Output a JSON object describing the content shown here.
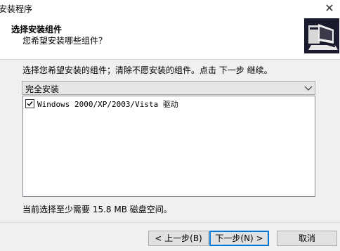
{
  "window": {
    "title": "安装程序",
    "close_glyph": "✕"
  },
  "header": {
    "title": "选择安装组件",
    "subtitle": "您希望安装哪些组件？",
    "logo_icon": "installer-computer-icon"
  },
  "main": {
    "instruction": "选择您希望安装的组件；清除不愿安装的组件。点击 下一步 继续。",
    "install_type": {
      "selected": "完全安装"
    },
    "components": [
      {
        "label": "Windows 2000/XP/2003/Vista 驱动",
        "checked": true
      }
    ],
    "space_required": "当前选择至少需要 15.8 MB 磁盘空间。"
  },
  "buttons": {
    "back": "< 上一步(B)",
    "next": "下一步(N) >",
    "cancel": "取消"
  },
  "colors": {
    "accent": "#0078d7",
    "logo_bg": "#1a1a2e"
  }
}
